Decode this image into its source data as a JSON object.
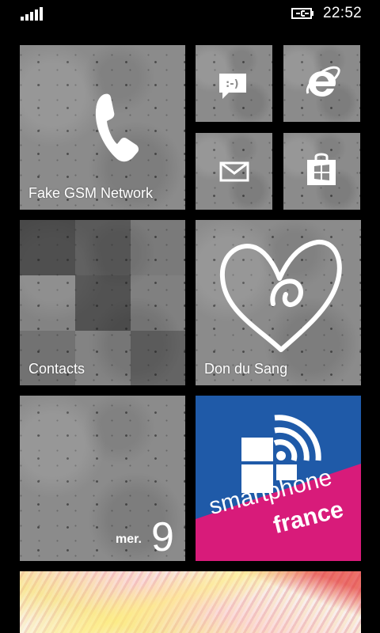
{
  "status_bar": {
    "time": "22:52",
    "signal_icon": "signal-bars-icon",
    "battery_icon": "battery-charging-icon"
  },
  "tiles": {
    "phone": {
      "label": "Fake GSM Network",
      "icon": "phone-icon"
    },
    "messaging": {
      "icon": "messaging-icon"
    },
    "internet_explorer": {
      "icon": "internet-explorer-icon"
    },
    "mail": {
      "icon": "mail-icon"
    },
    "store": {
      "icon": "store-icon"
    },
    "contacts": {
      "label": "Contacts"
    },
    "don_du_sang": {
      "label": "Don du Sang",
      "icon": "heart-icon"
    },
    "calendar": {
      "day": "mer.",
      "date": "9"
    },
    "smartphone_france": {
      "text_line1": "smartphone",
      "text_line2": "france",
      "brand_color": "#1f5aa8",
      "band_color": "#d81b7a"
    },
    "photos": {}
  },
  "colors": {
    "background": "#000000",
    "tile_gray": "#8b8b8b"
  }
}
